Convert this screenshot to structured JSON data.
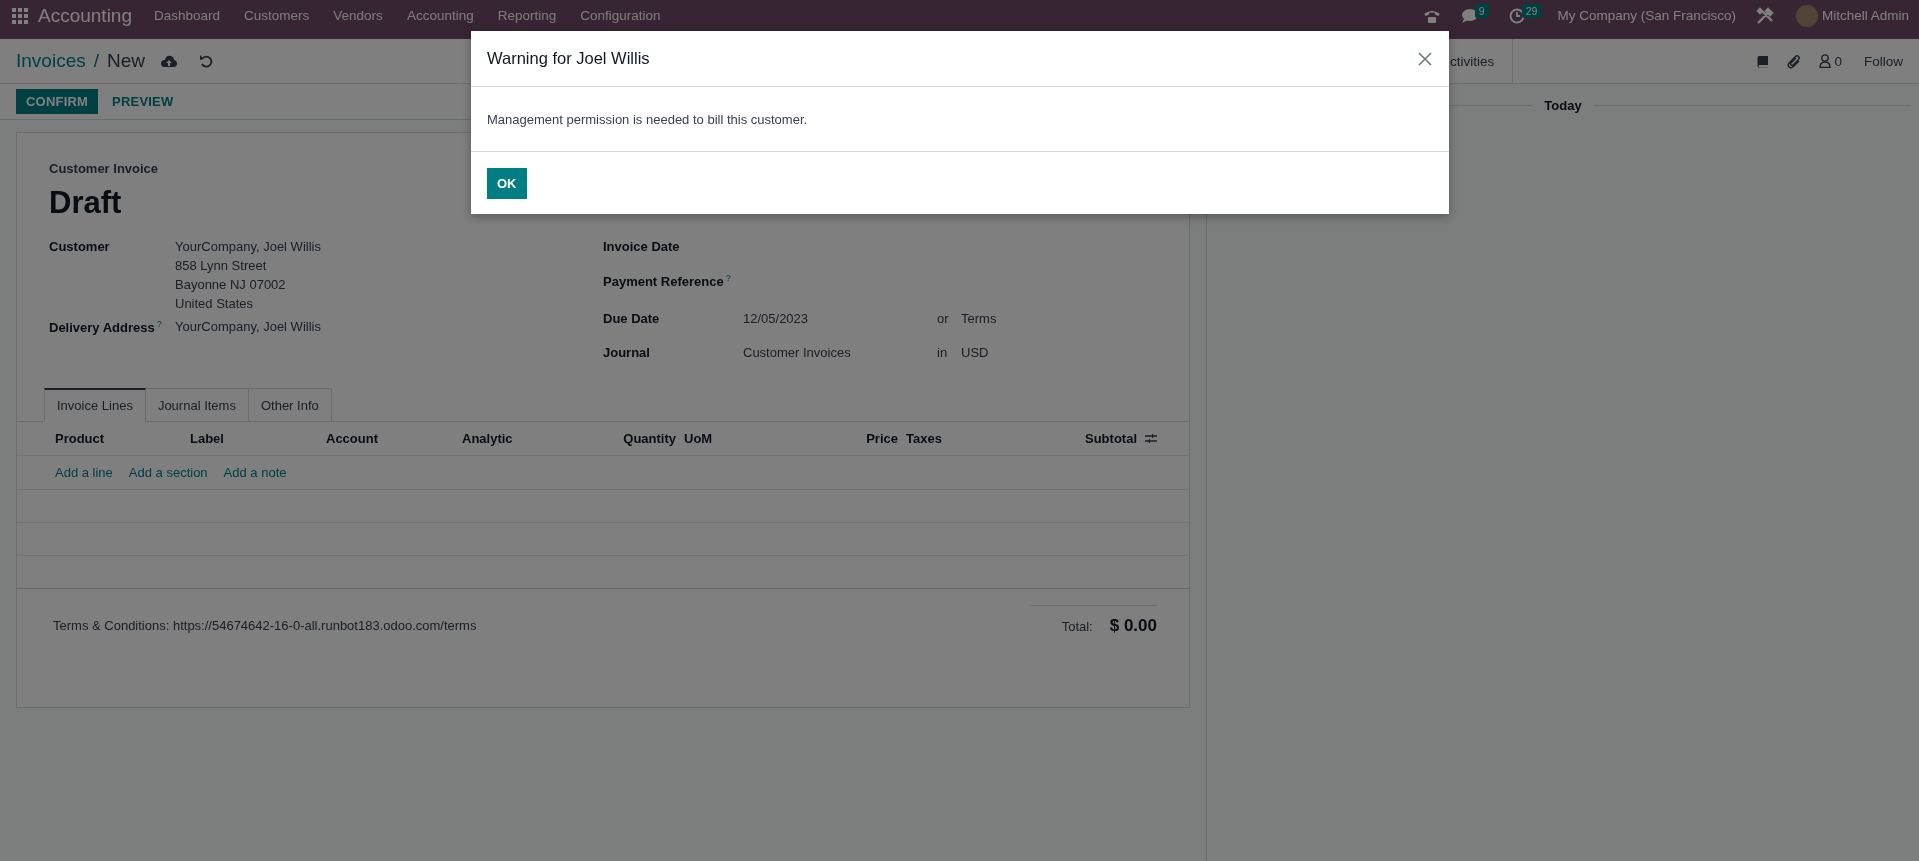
{
  "navbar": {
    "app": "Accounting",
    "menus": [
      "Dashboard",
      "Customers",
      "Vendors",
      "Accounting",
      "Reporting",
      "Configuration"
    ],
    "messages_count": "9",
    "activities_count": "29",
    "company": "My Company (San Francisco)",
    "user": "Mitchell Admin"
  },
  "breadcrumb": {
    "parent": "Invoices",
    "separator": "/",
    "current": "New"
  },
  "chatter": {
    "activities_button": "ctivities",
    "followers_count": "0",
    "follow_button": "Follow",
    "date_separator": "Today"
  },
  "actions": [
    {
      "label": "CONFIRM",
      "primary": true
    },
    {
      "label": "PREVIEW",
      "primary": false
    }
  ],
  "form": {
    "type_label": "Customer Invoice",
    "name": "Draft",
    "left_fields": [
      {
        "label": "Customer",
        "lines": [
          "YourCompany, Joel Willis",
          "858 Lynn Street",
          "Bayonne NJ 07002",
          "United States"
        ]
      },
      {
        "label": "Delivery Address",
        "help": "?",
        "lines": [
          "YourCompany, Joel Willis"
        ]
      }
    ],
    "right_fields": [
      {
        "label": "Invoice Date"
      },
      {
        "label": "Payment Reference",
        "help": "?"
      },
      {
        "label": "Due Date",
        "value": "12/05/2023",
        "connector": "or",
        "extra": "Terms"
      },
      {
        "label": "Journal",
        "value": "Customer Invoices",
        "connector": "in",
        "extra": "USD"
      }
    ],
    "tabs": [
      {
        "label": "Invoice Lines",
        "selected": true
      },
      {
        "label": "Journal Items",
        "selected": false
      },
      {
        "label": "Other Info",
        "selected": false
      }
    ],
    "columns": [
      {
        "label": "Product",
        "numeric": false
      },
      {
        "label": "Label",
        "numeric": false
      },
      {
        "label": "Account",
        "numeric": false
      },
      {
        "label": "Analytic",
        "numeric": false
      },
      {
        "label": "Quantity",
        "numeric": true
      },
      {
        "label": "UoM",
        "numeric": false
      },
      {
        "label": "Price",
        "numeric": true
      },
      {
        "label": "Taxes",
        "numeric": false
      },
      {
        "label": "Subtotal",
        "numeric": true
      }
    ],
    "add_links": [
      "Add a line",
      "Add a section",
      "Add a note"
    ],
    "terms": "Terms & Conditions: https://54674642-16-0-all.runbot183.odoo.com/terms",
    "total_label": "Total:",
    "total": "$ 0.00"
  },
  "dialog": {
    "title": "Warning for Joel Willis",
    "message": "Management permission is needed to bill this customer.",
    "buttons": [
      "OK"
    ]
  }
}
